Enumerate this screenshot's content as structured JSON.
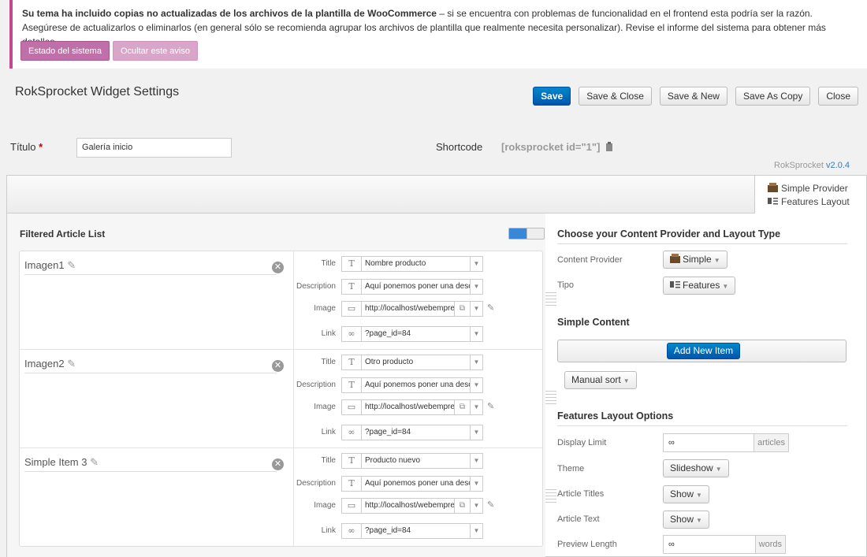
{
  "notice": {
    "bold_text": "Su tema ha incluido copias no actualizadas de los archivos de la plantilla de WooCommerce",
    "text": " – si se encuentra con problemas de funcionalidad en el frontend esta podría ser la razón. Asegúrese de actualizarlos o eliminarlos (en general sólo se recomienda agrupar los archivos de plantilla que realmente necesita personalizar). Revise el informe del sistema para obtener más detalles.",
    "btn_system": "Estado del sistema",
    "btn_hide": "Ocultar este aviso"
  },
  "header": {
    "title": "RokSprocket Widget Settings"
  },
  "toolbar": {
    "save": "Save",
    "save_close": "Save & Close",
    "save_new": "Save & New",
    "save_copy": "Save As Copy",
    "close": "Close"
  },
  "form": {
    "titulo_label": "Título",
    "required_mark": "*",
    "titulo_value": "Galería inicio",
    "shortcode_label": "Shortcode",
    "shortcode_value": "[roksprocket id=\"1\"]",
    "version_prefix": "RokSprocket ",
    "version": "v2.0.4"
  },
  "provider_box": {
    "provider": "Simple Provider",
    "layout": "Features Layout"
  },
  "left": {
    "title": "Filtered Article List",
    "field_labels": [
      "Title",
      "Description",
      "Image",
      "Link"
    ],
    "items": [
      {
        "name": "Imagen1",
        "title": "Nombre producto",
        "description": "Aquí ponemos poner una desc",
        "image": "http://localhost/webempres",
        "link": "?page_id=84"
      },
      {
        "name": "Imagen2",
        "title": "Otro producto",
        "description": "Aquí ponemos poner una desc",
        "image": "http://localhost/webempres",
        "link": "?page_id=84"
      },
      {
        "name": "Simple Item 3",
        "title": "Producto nuevo",
        "description": "Aquí ponemos poner una desc",
        "image": "http://localhost/webempres",
        "link": "?page_id=84"
      }
    ]
  },
  "right": {
    "section1": "Choose your Content Provider and Layout Type",
    "content_provider_label": "Content Provider",
    "content_provider_value": "Simple",
    "tipo_label": "Tipo",
    "tipo_value": "Features",
    "section2": "Simple Content",
    "add_new": "Add New Item",
    "manual_sort": "Manual sort",
    "section3": "Features Layout Options",
    "display_limit_label": "Display Limit",
    "display_limit_value": "∞",
    "display_limit_unit": "articles",
    "theme_label": "Theme",
    "theme_value": "Slideshow",
    "article_titles_label": "Article Titles",
    "article_titles_value": "Show",
    "article_text_label": "Article Text",
    "article_text_value": "Show",
    "preview_length_label": "Preview Length",
    "preview_length_value": "∞",
    "preview_length_unit": "words"
  }
}
